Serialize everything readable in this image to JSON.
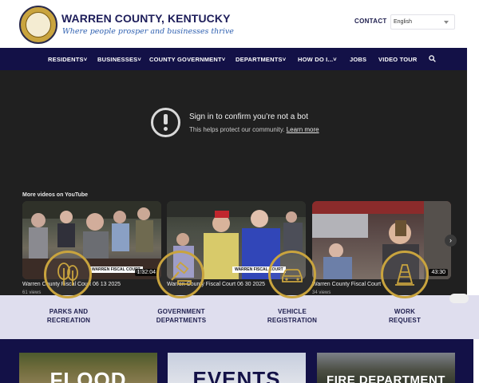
{
  "header": {
    "title": "WARREN COUNTY, KENTUCKY",
    "tagline": "Where people prosper and businesses thrive",
    "contact_label": "CONTACT",
    "language_selected": "English"
  },
  "nav": {
    "items": [
      "RESIDENTS˅",
      "BUSINESSES˅",
      "COUNTY GOVERNMENT˅",
      "DEPARTMENTS˅",
      "HOW DO I...˅",
      "JOBS",
      "VIDEO TOUR"
    ]
  },
  "video": {
    "message_title": "Sign in to confirm you’re not a bot",
    "message_sub": "This helps protect our community.",
    "message_link": "Learn more",
    "more_videos": "More videos on YouTube",
    "items": [
      {
        "title": "Warren County Fiscal Court 06 13 2025",
        "views": "61 views",
        "duration": "1:32:04",
        "badge": "WARREN FISCAL COURT"
      },
      {
        "title": "Warren County Fiscal Court 06 30 2025",
        "views": "",
        "duration": "",
        "badge": "WARREN FISCAL COURT"
      },
      {
        "title": "Warren County Fiscal Court",
        "views": "34 views",
        "duration": "43:30",
        "badge": ""
      }
    ]
  },
  "quick_links": [
    {
      "line1": "PARKS AND",
      "line2": "RECREATION",
      "icon": "trees-icon"
    },
    {
      "line1": "GOVERNMENT",
      "line2": "DEPARTMENTS",
      "icon": "gavel-icon"
    },
    {
      "line1": "VEHICLE",
      "line2": "REGISTRATION",
      "icon": "car-icon"
    },
    {
      "line1": "WORK",
      "line2": "REQUEST",
      "icon": "traffic-cone-icon"
    }
  ],
  "features": [
    "FLOOD",
    "EVENTS",
    "FIRE DEPARTMENT"
  ],
  "colors": {
    "navy": "#131147",
    "gold": "#c9a43e",
    "lavender": "#dfdeee"
  }
}
